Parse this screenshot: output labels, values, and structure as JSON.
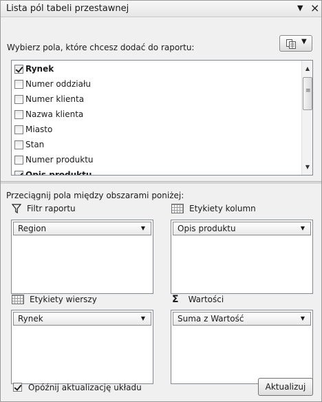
{
  "pane": {
    "title": "Lista pól tabeli przestawnej",
    "dropdown_icon": "▼",
    "close_icon": "×"
  },
  "chooser": {
    "label": "Wybierz pola, które chcesz dodać do raportu:",
    "layout_caret": "▼"
  },
  "fields": [
    {
      "label": "Rynek",
      "checked": true,
      "bold": true
    },
    {
      "label": "Numer oddziału",
      "checked": false,
      "bold": false
    },
    {
      "label": "Numer klienta",
      "checked": false,
      "bold": false
    },
    {
      "label": "Nazwa klienta",
      "checked": false,
      "bold": false
    },
    {
      "label": "Miasto",
      "checked": false,
      "bold": false
    },
    {
      "label": "Stan",
      "checked": false,
      "bold": false
    },
    {
      "label": "Numer produktu",
      "checked": false,
      "bold": false
    },
    {
      "label": "Opis produktu",
      "checked": true,
      "bold": true
    }
  ],
  "scrollbar": {
    "up": "▲",
    "down": "▼"
  },
  "areas": {
    "instruction": "Przeciągnij pola między obszarami poniżej:",
    "report_filter": {
      "title": "Filtr raportu",
      "icon": "filter-icon",
      "field": "Region",
      "caret": "▼"
    },
    "column_labels": {
      "title": "Etykiety kolumn",
      "icon": "grid-icon",
      "field": "Opis produktu",
      "caret": "▼"
    },
    "row_labels": {
      "title": "Etykiety wierszy",
      "icon": "grid-icon",
      "field": "Rynek",
      "caret": "▼"
    },
    "values": {
      "title": "Wartości",
      "icon": "sigma-icon",
      "symbol": "Σ",
      "field": "Suma z Wartość",
      "caret": "▼"
    }
  },
  "footer": {
    "defer_label": "Opóźnij aktualizację układu",
    "defer_checked": true,
    "update_button": "Aktualizuj"
  }
}
